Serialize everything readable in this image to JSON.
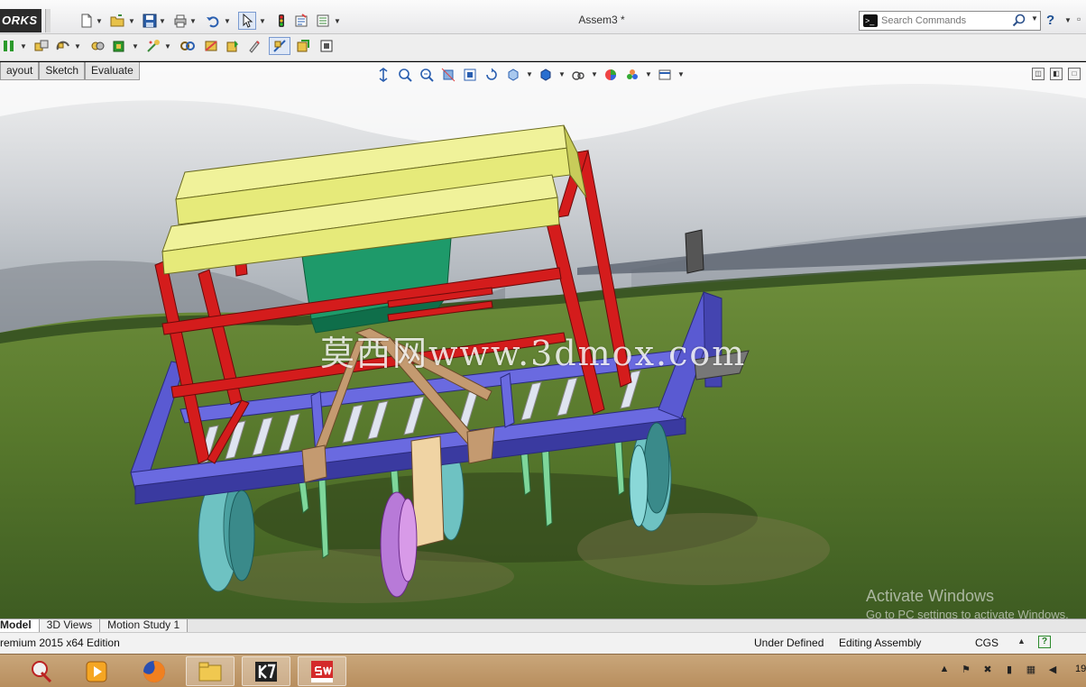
{
  "app": {
    "logo_text": "ORKS",
    "document_title": "Assem3 *"
  },
  "search": {
    "placeholder": "Search Commands",
    "cmd_glyph": ">_"
  },
  "command_tabs": [
    "ayout",
    "Sketch",
    "Evaluate"
  ],
  "viewport": {
    "watermark": "莫西网www.3dmox.com",
    "activation_title": "Activate Windows",
    "activation_sub": "Go to PC settings to activate Windows."
  },
  "bottom_tabs": [
    "Model",
    "3D Views",
    "Motion Study 1"
  ],
  "status": {
    "edition": "remium 2015 x64 Edition",
    "definition": "Under Defined",
    "mode": "Editing Assembly",
    "units": "CGS"
  },
  "taskbar": {
    "clock": "19"
  },
  "colors": {
    "frame_blue": "#5a5ad2",
    "frame_red": "#d41c1c",
    "hopper_yellow": "#e6ea7a",
    "box_green": "#1e9a6a",
    "disc_teal": "#6ec2c2",
    "wheel_purple": "#b87ad8",
    "link_tan": "#c49a70"
  }
}
